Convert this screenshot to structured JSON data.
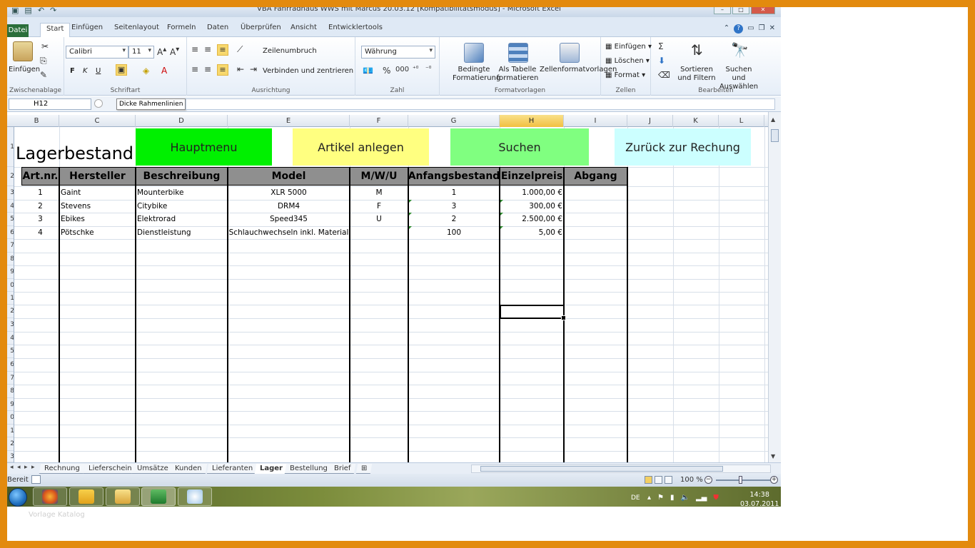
{
  "window": {
    "title": "VBA Fahrradhaus WWS mit Marcus 20.03.12 [Kompatibilitätsmodus] - Microsoft Excel"
  },
  "ribbon_tabs": [
    "Datei",
    "Start",
    "Einfügen",
    "Seitenlayout",
    "Formeln",
    "Daten",
    "Überprüfen",
    "Ansicht",
    "Entwicklertools"
  ],
  "active_tab": "Start",
  "ribbon": {
    "clipboard": {
      "paste": "Einfügen",
      "label": "Zwischenablage"
    },
    "font": {
      "name": "Calibri",
      "size": "11",
      "bold": "F",
      "italic": "K",
      "underline": "U",
      "label": "Schriftart"
    },
    "alignment": {
      "wrap": "Zeilenumbruch",
      "merge": "Verbinden und zentrieren",
      "label": "Ausrichtung"
    },
    "number": {
      "format": "Währung",
      "label": "Zahl"
    },
    "styles": {
      "conditional": "Bedingte Formatierung",
      "as_table": "Als Tabelle formatieren",
      "cell_styles": "Zellenformatvorlagen",
      "label": "Formatvorlagen"
    },
    "cells": {
      "insert": "Einfügen",
      "delete": "Löschen",
      "format": "Format",
      "label": "Zellen"
    },
    "editing": {
      "sort": "Sortieren und Filtern",
      "find": "Suchen und Auswählen",
      "label": "Bearbeiten"
    }
  },
  "formula_bar": {
    "name_box": "H12",
    "tooltip": "Dicke Rahmenlinien",
    "value": ""
  },
  "columns": [
    "B",
    "C",
    "D",
    "E",
    "F",
    "G",
    "H",
    "I",
    "J",
    "K",
    "L"
  ],
  "selected_column": "H",
  "row_numbers": [
    "1",
    "2",
    "3",
    "4",
    "5",
    "6",
    "7",
    "8",
    "9",
    "10",
    "11",
    "12",
    "13",
    "14",
    "15",
    "16",
    "17",
    "18",
    "19",
    "20",
    "21",
    "22",
    "23"
  ],
  "sheet": {
    "title": "Lagerbestand",
    "buttons": {
      "hauptmenu": "Hauptmenu",
      "artikel": "Artikel anlegen",
      "suchen": "Suchen",
      "zurueck": "Zurück zur Rechung"
    },
    "headers": [
      "Art.nr.",
      "Hersteller",
      "Beschreibung",
      "Model",
      "M/W/U",
      "Anfangsbestand",
      "Einzelpreis",
      "Abgang"
    ],
    "rows": [
      {
        "nr": "1",
        "hersteller": "Gaint",
        "beschreibung": "Mounterbike",
        "model": "XLR 5000",
        "mwu": "M",
        "bestand": "1",
        "preis": "1.000,00 €"
      },
      {
        "nr": "2",
        "hersteller": "Stevens",
        "beschreibung": "Citybike",
        "model": "DRM4",
        "mwu": "F",
        "bestand": "3",
        "preis": "300,00 €"
      },
      {
        "nr": "3",
        "hersteller": "Ebikes",
        "beschreibung": "Elektrorad",
        "model": "Speed345",
        "mwu": "U",
        "bestand": "2",
        "preis": "2.500,00 €"
      },
      {
        "nr": "4",
        "hersteller": "Pötschke",
        "beschreibung": "Dienstleistung",
        "model": "Schlauchwechseln inkl. Material",
        "mwu": "",
        "bestand": "100",
        "preis": "5,00 €"
      }
    ]
  },
  "sheet_tabs": [
    "Rechnung",
    "Lieferschein",
    "Umsätze",
    "Kunden",
    "Lieferanten",
    "Lager",
    "Bestellung",
    "Brief"
  ],
  "active_sheet": "Lager",
  "status": {
    "ready": "Bereit",
    "zoom": "100 %"
  },
  "taskbar": {
    "lang": "DE",
    "time": "14:38",
    "date": "03.07.2011"
  },
  "caption": "Vorlage Katalog",
  "colors": {
    "hauptmenu": "#00f000",
    "artikel": "#ffff80",
    "suchen": "#80ff80",
    "zurueck": "#ccffff",
    "header_gray": "#8f8f8f"
  }
}
